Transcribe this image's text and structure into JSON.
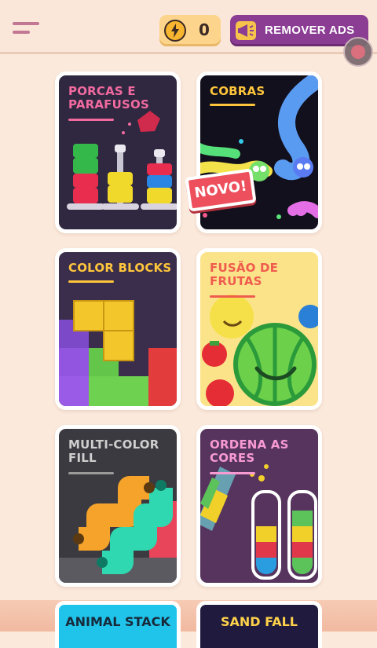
{
  "header": {
    "menu_icon": "hamburger-menu-icon",
    "coins": {
      "icon": "lightning-coin-icon",
      "value": "0"
    },
    "remove_ads": {
      "icon": "megaphone-icon",
      "label": "REMOVER ADS"
    }
  },
  "games": [
    {
      "title": "PORCAS E\nPARAFUSOS",
      "title_color": "#f26aa0",
      "underline": "#f26aa0"
    },
    {
      "title": "COBRAS",
      "title_color": "#ffc53b",
      "underline": "#ffc53b",
      "badge": "NOVO!"
    },
    {
      "title": "COLOR BLOCKS",
      "title_color": "#ffc53b",
      "underline": "#ffc53b"
    },
    {
      "title": "FUSÃO DE\nFRUTAS",
      "title_color": "#ef5c4e",
      "underline": "#ef5c4e"
    },
    {
      "title": "MULTI-COLOR\nFILL",
      "title_color": "#cfcfcf",
      "underline": "#9a9a9a"
    },
    {
      "title": "ORDENA AS\nCORES",
      "title_color": "#f79ad2",
      "underline": "#f79ad2"
    }
  ],
  "peek_games": [
    {
      "title": "ANIMAL STACK"
    },
    {
      "title": "SAND FALL"
    }
  ]
}
